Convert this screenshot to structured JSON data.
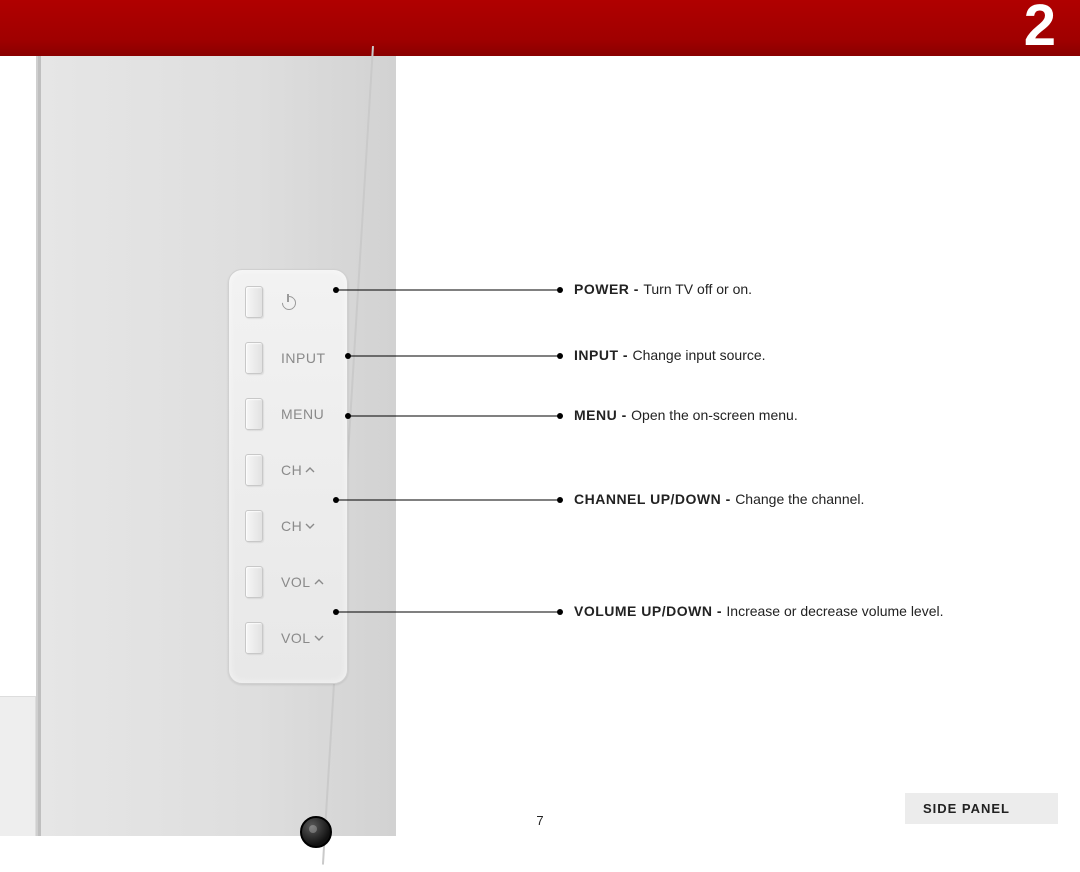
{
  "chapter_number": "2",
  "page_number": "7",
  "section_label": "SIDE PANEL",
  "panel": {
    "buttons": [
      {
        "label_type": "icon",
        "icon": "power"
      },
      {
        "label_type": "text",
        "text": "INPUT"
      },
      {
        "label_type": "text",
        "text": "MENU"
      },
      {
        "label_type": "ch",
        "text": "CH",
        "dir": "up"
      },
      {
        "label_type": "ch",
        "text": "CH",
        "dir": "down"
      },
      {
        "label_type": "ch",
        "text": "VOL",
        "dir": "up"
      },
      {
        "label_type": "ch",
        "text": "VOL",
        "dir": "down"
      }
    ]
  },
  "descriptions": {
    "power": {
      "title": "POWER - ",
      "text": "Turn TV off or on."
    },
    "input": {
      "title": "INPUT - ",
      "text": "Change input source."
    },
    "menu": {
      "title": "MENU - ",
      "text": "Open the on-screen menu."
    },
    "channel": {
      "title": "CHANNEL UP/DOWN - ",
      "text": "Change the channel."
    },
    "volume": {
      "title": "VOLUME UP/DOWN - ",
      "text": "Increase or decrease volume level."
    }
  }
}
